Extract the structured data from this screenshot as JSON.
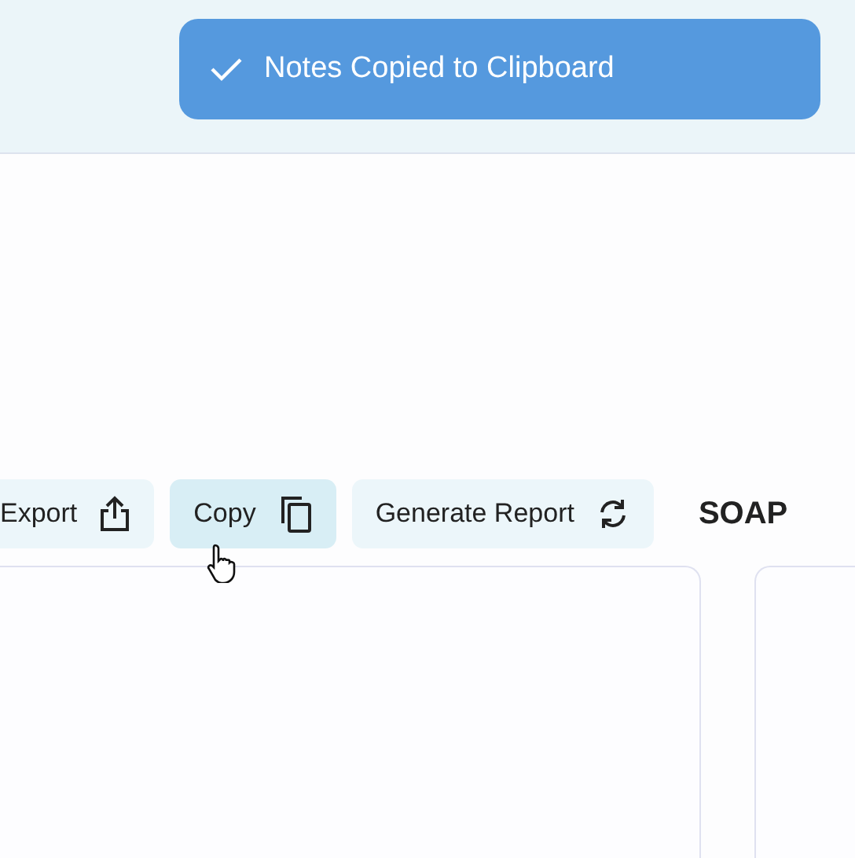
{
  "toast": {
    "text": "Notes Copied to Clipboard"
  },
  "actions": [
    {
      "label": "Export",
      "hovered": false
    },
    {
      "label": "Copy",
      "hovered": true
    },
    {
      "label": "Generate Report",
      "hovered": false
    }
  ],
  "soap_heading": "SOAP"
}
